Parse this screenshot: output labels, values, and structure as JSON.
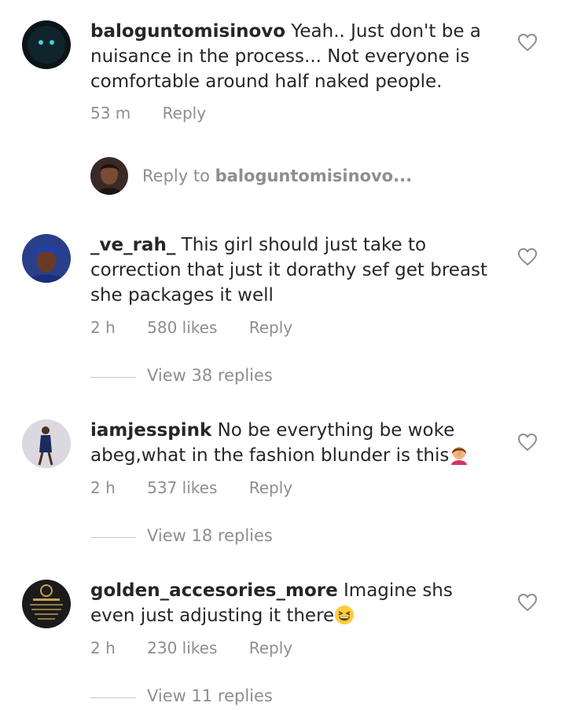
{
  "comments": [
    {
      "username": "baloguntomisinovo",
      "text": "Yeah.. Just don't be a nuisance in the process... Not everyone is comfortable around half naked people.",
      "time": "53 m",
      "likes": "",
      "reply_label": "Reply"
    },
    {
      "username": "_ve_rah_",
      "text": "This girl should just take to correction that just it dorathy sef get breast she packages it well",
      "time": "2 h",
      "likes": "580 likes",
      "reply_label": "Reply",
      "view_replies": "View 38 replies"
    },
    {
      "username": "iamjesspink",
      "text": "No be everything be woke abeg,what in the fashion blunder is this",
      "emoji": "woman-facepalming",
      "time": "2 h",
      "likes": "537 likes",
      "reply_label": "Reply",
      "view_replies": "View 18 replies"
    },
    {
      "username": "golden_accesories_more",
      "text": "Imagine shs even just adjusting it there",
      "emoji": "grinning-squinting-face",
      "time": "2 h",
      "likes": "230 likes",
      "reply_label": "Reply",
      "view_replies": "View 11 replies"
    }
  ],
  "reply_composer": {
    "prefix": "Reply to",
    "target": "baloguntomisinovo..."
  },
  "colors": {
    "text": "#262626",
    "secondary": "#8e8e8e",
    "divider": "#c7c7c7"
  }
}
